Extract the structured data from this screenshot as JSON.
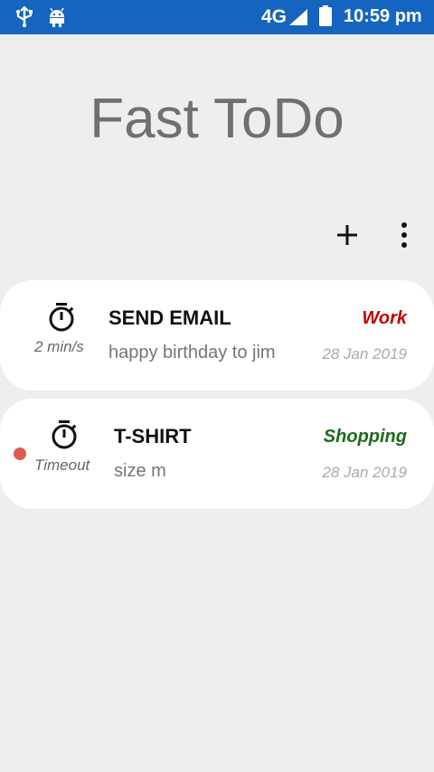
{
  "status_bar": {
    "icons": [
      "usb-icon",
      "android-icon"
    ],
    "network": "4G",
    "time": "10:59 pm",
    "color": "#1565c0"
  },
  "app": {
    "title": "Fast ToDo"
  },
  "toolbar": {
    "add_icon": "plus-icon",
    "more_icon": "more-vert-icon"
  },
  "tasks": [
    {
      "timer_label": "2 min/s",
      "title": "SEND EMAIL",
      "description": "happy birthday to jim",
      "category": "Work",
      "category_color": "#c00000",
      "date": "28 Jan 2019",
      "timeout_dot": false
    },
    {
      "timer_label": "Timeout",
      "title": "T-SHIRT",
      "description": "size m",
      "category": "Shopping",
      "category_color": "#1b6b1b",
      "date": "28 Jan 2019",
      "timeout_dot": true,
      "dot_color": "#e05a52"
    }
  ]
}
